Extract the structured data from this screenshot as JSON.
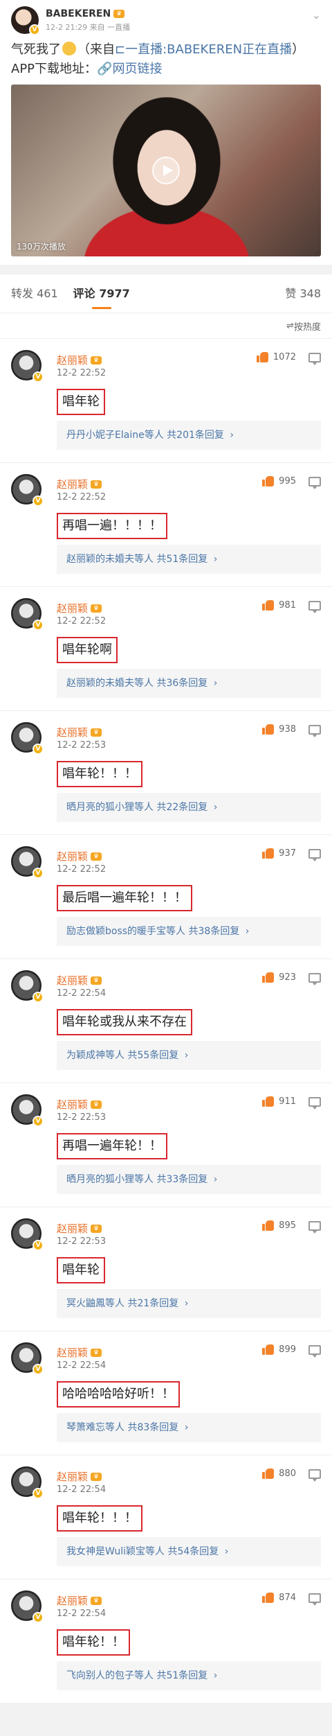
{
  "post": {
    "author": "BABEKEREN",
    "crown": "♛",
    "time": "12-2 21:29",
    "source": "来自 一直播",
    "text_before": "气死我了",
    "text_after": "（来自",
    "text_link": "一直播:BABEKEREN正在直播",
    "text_tail": "）APP下载地址：",
    "web_link": "网页链接",
    "views": "130万次播放"
  },
  "tabs": {
    "reposts_label": "转发",
    "reposts_count": "461",
    "comments_label": "评论",
    "comments_count": "7977",
    "likes_label": "赞",
    "likes_count": "348"
  },
  "sort": {
    "label": "按热度"
  },
  "comments": [
    {
      "name": "赵丽颖",
      "time": "12-2 22:52",
      "likes": "1072",
      "text": "唱年轮",
      "replies": "丹丹小妮子Elaine等人",
      "reply_count": "共201条回复"
    },
    {
      "name": "赵丽颖",
      "time": "12-2 22:52",
      "likes": "995",
      "text": "再唱一遍！！！！",
      "replies": "赵丽颖的未婚夫等人",
      "reply_count": "共51条回复"
    },
    {
      "name": "赵丽颖",
      "time": "12-2 22:52",
      "likes": "981",
      "text": "唱年轮啊",
      "replies": "赵丽颖的未婚夫等人",
      "reply_count": "共36条回复"
    },
    {
      "name": "赵丽颖",
      "time": "12-2 22:53",
      "likes": "938",
      "text": "唱年轮！！！",
      "replies": "晒月亮的狐小狸等人",
      "reply_count": "共22条回复"
    },
    {
      "name": "赵丽颖",
      "time": "12-2 22:52",
      "likes": "937",
      "text": "最后唱一遍年轮！！！",
      "replies": "励志做颖boss的暖手宝等人",
      "reply_count": "共38条回复"
    },
    {
      "name": "赵丽颖",
      "time": "12-2 22:54",
      "likes": "923",
      "text": "唱年轮或我从来不存在",
      "replies": "为颖成神等人",
      "reply_count": "共55条回复"
    },
    {
      "name": "赵丽颖",
      "time": "12-2 22:53",
      "likes": "911",
      "text": "再唱一遍年轮！！",
      "replies": "晒月亮的狐小狸等人",
      "reply_count": "共33条回复"
    },
    {
      "name": "赵丽颖",
      "time": "12-2 22:53",
      "likes": "895",
      "text": "唱年轮",
      "replies": "冥火鼬鳳等人",
      "reply_count": "共21条回复"
    },
    {
      "name": "赵丽颖",
      "time": "12-2 22:54",
      "likes": "899",
      "text": "哈哈哈哈哈好听！！",
      "replies": "琴箫难忘等人",
      "reply_count": "共83条回复"
    },
    {
      "name": "赵丽颖",
      "time": "12-2 22:54",
      "likes": "880",
      "text": "唱年轮！！！",
      "replies": "我女神是Wuli颖宝等人",
      "reply_count": "共54条回复"
    },
    {
      "name": "赵丽颖",
      "time": "12-2 22:54",
      "likes": "874",
      "text": "唱年轮！！",
      "replies": "飞向别人的包子等人",
      "reply_count": "共51条回复"
    }
  ]
}
